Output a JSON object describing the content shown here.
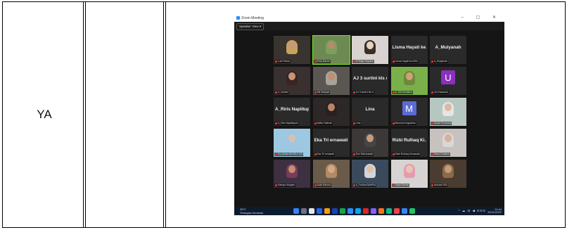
{
  "table": {
    "left_cell_text": "YA"
  },
  "zoom": {
    "window_title": "Zoom Meeting",
    "window_controls": "–  ▢  ✕",
    "view_button": "Speaker View ▾",
    "tiles": [
      {
        "kind": "photo",
        "label": "Lulu Fatma",
        "skin": "#c49a7a",
        "veil": "#c8a15a",
        "bg": "#3a3430"
      },
      {
        "kind": "photo",
        "label": "Rezy Banne",
        "skin": "#b88a66",
        "veil": "#7aa060",
        "bg": "#6c8a52",
        "highlight": true
      },
      {
        "kind": "photo",
        "label": "A.Tegar Saputra",
        "skin": "#e8d2c0",
        "veil": "#3b2f2a",
        "bg": "#d8d3d0"
      },
      {
        "kind": "text",
        "big": "Lisma Hayati ke...",
        "label": "Lisma Hayati ke AIFA"
      },
      {
        "kind": "text",
        "big": "A_Mulyanah",
        "label": "A_Mulyanah"
      },
      {
        "kind": "photo",
        "label": "A_Nuraini",
        "skin": "#c69476",
        "veil": "#3a2424",
        "bg": "#3a3030"
      },
      {
        "kind": "photo",
        "label": "Siti Sadiyah",
        "skin": "#c08e70",
        "veil": "#a8a29a",
        "bg": "#5a5652"
      },
      {
        "kind": "text",
        "big": "AJ 3 surtini kls A",
        "label": "AJ 3 surtini kls A"
      },
      {
        "kind": "photo",
        "label": "A_Siti Nurhaliza",
        "skin": "#d0a07c",
        "veil": "#6b8a3a",
        "bg": "#7ab04a"
      },
      {
        "kind": "letter",
        "letter": "U",
        "color": "#8a2fbf",
        "label": "Uni Hasanah"
      },
      {
        "kind": "text",
        "big": "A_Riris Naplitup...",
        "label": "A_Riris Naplitupulu"
      },
      {
        "kind": "photo",
        "label": "Aldila Fatimah",
        "skin": "#b98467",
        "veil": "#2a2020",
        "bg": "#2e2727"
      },
      {
        "kind": "text",
        "big": "Lina",
        "label": "Lina"
      },
      {
        "kind": "letter",
        "letter": "M",
        "color": "#5b6bd6",
        "label": "Masnuroh Agustina"
      },
      {
        "kind": "photo",
        "label": "Azrah Fernanda",
        "skin": "#d9b9a0",
        "veil": "#e5e5e5",
        "bg": "#b6c6c0"
      },
      {
        "kind": "photo",
        "label": "Ery Melita BAHRIA 305",
        "skin": "#d8c0b0",
        "veil": "#a0c6de",
        "bg": "#9cc8e2"
      },
      {
        "kind": "text",
        "big": "Eka Tri ernawati",
        "label": "Eka Tri ernawati"
      },
      {
        "kind": "photo",
        "label": "Erni Rahmawati",
        "skin": "#c79b7a",
        "veil": "#454545",
        "bg": "#3c3838"
      },
      {
        "kind": "text",
        "big": "Rizki Rulhaq Ki...",
        "label": "Rizki Rulhaq Kirmawati"
      },
      {
        "kind": "photo",
        "label": "Dewi Christine",
        "skin": "#d6b09a",
        "veil": "#d8d8d8",
        "bg": "#c7c2bf"
      },
      {
        "kind": "photo",
        "label": "Rahayu Ningsih",
        "skin": "#c28f70",
        "veil": "#7a3a5a",
        "bg": "#3d3040"
      },
      {
        "kind": "photo",
        "label": "Aulia Rahma",
        "skin": "#d3a88a",
        "veil": "#b08a62",
        "bg": "#6a5a4a"
      },
      {
        "kind": "photo",
        "label": "A_Fedina BAHRIA",
        "skin": "#e0c0a8",
        "veil": "#cfd6de",
        "bg": "#3a4a5c"
      },
      {
        "kind": "photo",
        "label": "Tegar Shinta",
        "skin": "#e4c6b2",
        "veil": "#e79ab0",
        "bg": "#d6d3d2"
      },
      {
        "kind": "photo",
        "label": "Nurhaiti 305",
        "skin": "#c59b7c",
        "veil": "#8a6a4a",
        "bg": "#4a3c30"
      }
    ],
    "taskbar": {
      "weather_temp": "28°C",
      "weather_desc": "Sebagian berawan",
      "tray_symbols": "^ ☁ ⊡ ◀ ENG",
      "time": "11:44",
      "date": "30/11/2022",
      "app_colors": [
        "#3b82f6",
        "#6b7280",
        "#e5e7eb",
        "#2563eb",
        "#f59e0b",
        "#1e40af",
        "#16a34a",
        "#2d8cff",
        "#0ea5e9",
        "#dc2626",
        "#8b5cf6",
        "#f97316",
        "#10b981",
        "#ef4444",
        "#3b82f6",
        "#22c55e"
      ]
    }
  }
}
